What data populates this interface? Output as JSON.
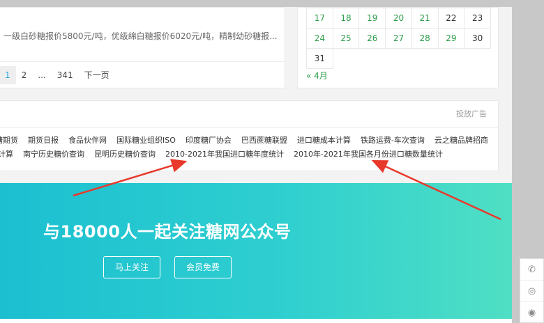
{
  "news": {
    "snippet": "一级白砂糖报价5800元/吨，优级绵白糖报价6020元/吨，精制幼砂糖报...",
    "pagination": [
      "1",
      "2",
      "...",
      "341",
      "下一页"
    ]
  },
  "calendar": {
    "rows": [
      [
        {
          "d": "17",
          "link": true
        },
        {
          "d": "18",
          "link": true
        },
        {
          "d": "19",
          "link": true
        },
        {
          "d": "20",
          "link": true
        },
        {
          "d": "21",
          "link": true
        },
        {
          "d": "22",
          "link": false
        },
        {
          "d": "23",
          "link": false
        }
      ],
      [
        {
          "d": "24",
          "link": true
        },
        {
          "d": "25",
          "link": true
        },
        {
          "d": "26",
          "link": true
        },
        {
          "d": "27",
          "link": true
        },
        {
          "d": "28",
          "link": true
        },
        {
          "d": "29",
          "link": true
        },
        {
          "d": "30",
          "link": false
        }
      ],
      [
        {
          "d": "31",
          "link": false
        }
      ]
    ],
    "prev_month": "« 4月"
  },
  "links": {
    "ad_label": "投放广告",
    "row1": [
      "糖期货",
      "期货日报",
      "食品伙伴网",
      "国际糖业组织ISO",
      "印度糖厂协会",
      "巴西蔗糖联盟",
      "进口糖成本计算",
      "铁路运费-车次查询",
      "云之糖品牌招商"
    ],
    "row2": [
      "计算",
      "南宁历史糖价查询",
      "昆明历史糖价查询",
      "2010-2021年我国进口糖年度统计",
      "2010年-2021年我国各月份进口糖数量统计"
    ]
  },
  "banner": {
    "title": "与18000人一起关注糖网公众号",
    "btn_follow": "马上关注",
    "btn_free": "会员免费"
  },
  "side_tools": [
    {
      "icon": "phone-icon",
      "glyph": "✆"
    },
    {
      "icon": "wechat-icon",
      "glyph": "◎"
    },
    {
      "icon": "weibo-icon",
      "glyph": "◉"
    }
  ],
  "colors": {
    "link_green": "#2b9d49",
    "active_blue": "#2ea7e0",
    "annotation_red": "#e8392c"
  }
}
